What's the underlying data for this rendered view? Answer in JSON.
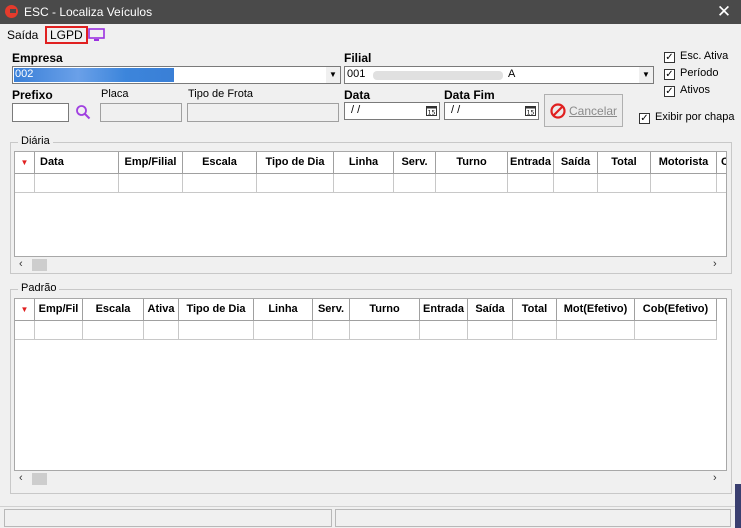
{
  "window": {
    "title": "ESC - Localiza Veículos",
    "close_glyph": "✕"
  },
  "menu": {
    "saida": "Saída",
    "lgpd": "LGPD"
  },
  "fields": {
    "empresa_label": "Empresa",
    "empresa_value": "002",
    "filial_label": "Filial",
    "filial_value": "001",
    "filial_suffix": "A",
    "prefixo_label": "Prefixo",
    "placa_label": "Placa",
    "tipo_frota_label": "Tipo de Frota",
    "data_label": "Data",
    "data_value": "/ /",
    "data_fim_label": "Data Fim",
    "data_fim_value": "/ /",
    "cancelar_label": "Cancelar"
  },
  "checkboxes": {
    "esc_ativa": "Esc. Ativa",
    "periodo": "Período",
    "ativos": "Ativos",
    "exibir_chapa": "Exibir por chapa"
  },
  "diaria": {
    "title": "Diária",
    "columns": [
      "Data",
      "Emp/Filial",
      "Escala",
      "Tipo de Dia",
      "Linha",
      "Serv.",
      "Turno",
      "Entrada",
      "Saída",
      "Total",
      "Motorista",
      "Cob"
    ]
  },
  "padrao": {
    "title": "Padrão",
    "columns": [
      "Emp/Fil",
      "Escala",
      "Ativa",
      "Tipo de Dia",
      "Linha",
      "Serv.",
      "Turno",
      "Entrada",
      "Saída",
      "Total",
      "Mot(Efetivo)",
      "Cob(Efetivo)"
    ]
  },
  "icons": {
    "app": "app-logo-icon",
    "monitor": "monitor-icon",
    "search": "search-icon",
    "calendar": "calendar-icon",
    "cancel": "cancel-icon"
  },
  "colors": {
    "title_bar": "#4a4a4a",
    "lgpd_border": "#e02020",
    "selection_blue": "#3a80d8",
    "search_purple": "#a040e0"
  }
}
